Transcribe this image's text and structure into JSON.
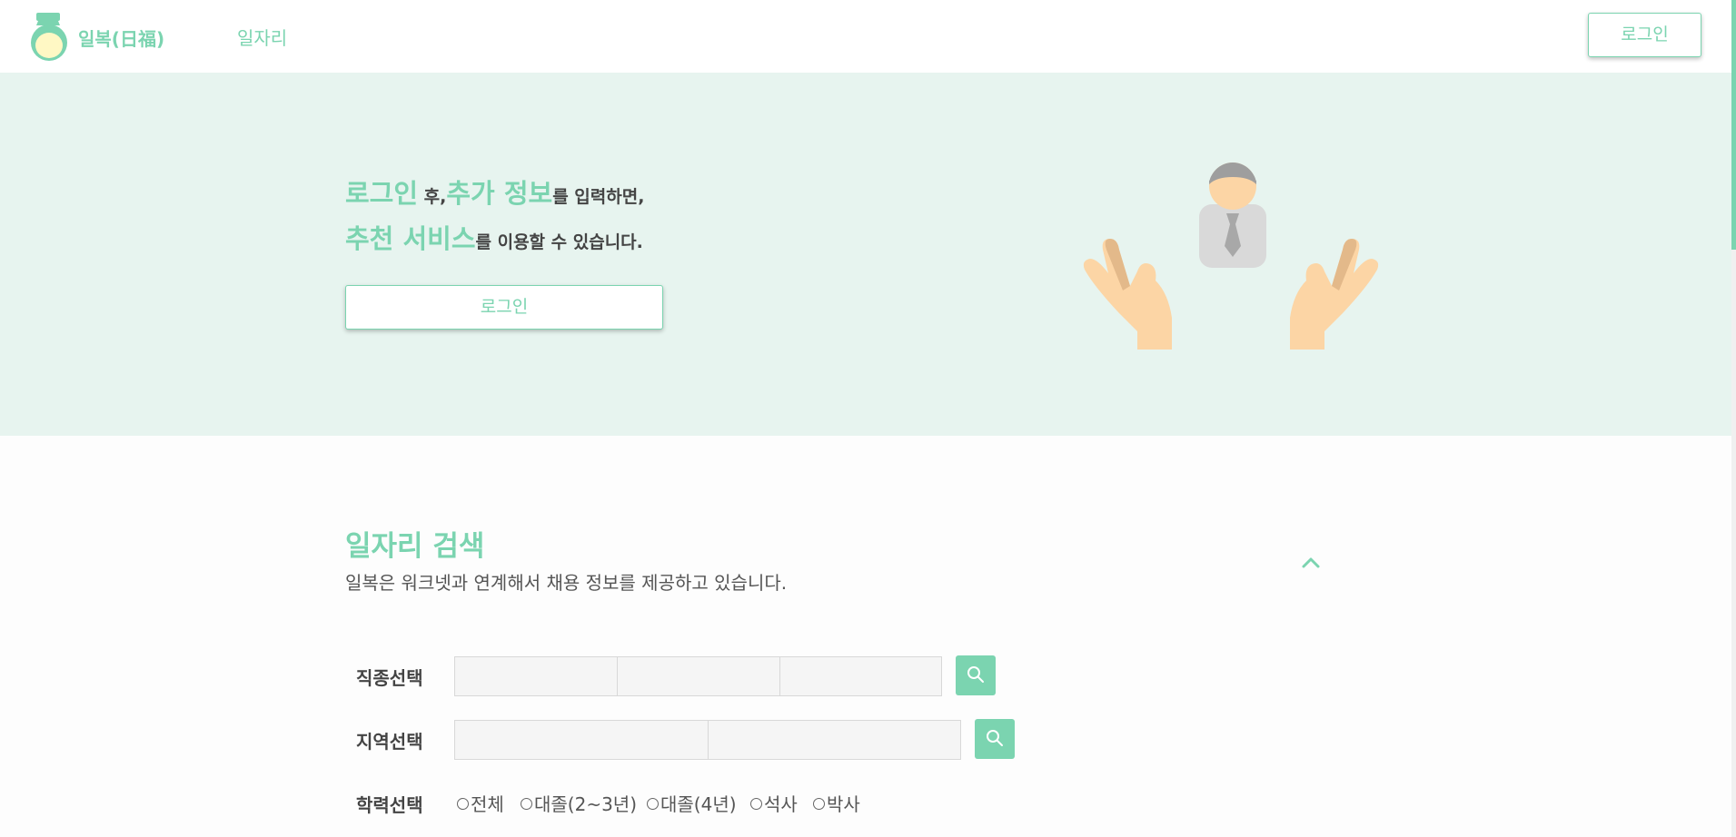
{
  "header": {
    "brand": "일복(日福)",
    "nav_jobs": "일자리",
    "login_label": "로그인"
  },
  "hero": {
    "line1": {
      "hl1": "로그인",
      "t1": " 후,",
      "hl2": "추가 정보",
      "t2": "를 입력하면,"
    },
    "line2": {
      "hl": "추천 서비스",
      "t": "를 이용할 수 있습니다."
    },
    "login_label": "로그인"
  },
  "search": {
    "title": "일자리 검색",
    "description": "일복은 워크넷과 연계해서 채용 정보를 제공하고 있습니다.",
    "job_label": "직종선택",
    "region_label": "지역선택",
    "education_label": "학력선택",
    "education_options": [
      "전체",
      "대졸(2~3년)",
      "대졸(4년)",
      "석사",
      "박사"
    ]
  },
  "colors": {
    "accent": "#7bd4b0",
    "hero_bg": "#e7f4ef"
  },
  "icons": [
    "logo-icon",
    "collapse-chevron-icon",
    "search-icon",
    "helping-hands-illustration"
  ]
}
